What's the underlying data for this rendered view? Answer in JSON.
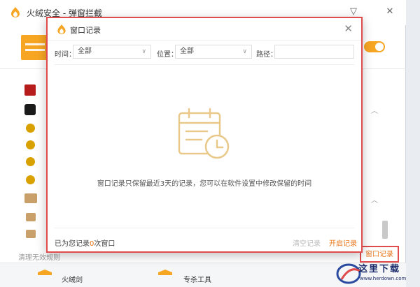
{
  "main_window": {
    "title": "火绒安全 - 弹窗拦截",
    "minimize_label": "▽",
    "close_label": "✕",
    "cleanup_label": "清理无效规则",
    "record_button_label": "窗口记录",
    "bottom_tools": [
      "火绒剑",
      "专杀工具"
    ]
  },
  "dialog": {
    "title": "窗口记录",
    "close_label": "✕",
    "filters": {
      "time_label": "时间：",
      "time_value": "全部",
      "position_label": "位置：",
      "position_value": "全部",
      "path_label": "路径：",
      "path_value": ""
    },
    "empty_message": "窗口记录只保留最近3天的记录，您可以在软件设置中修改保留的时间",
    "footer": {
      "record_prefix": "已为您记录",
      "record_count": "0",
      "record_suffix": "次窗口",
      "clear_label": "清空记录",
      "open_label": "开启记录"
    }
  },
  "watermark": {
    "text": "这里下载",
    "url": "www.herdown.com"
  },
  "colors": {
    "accent": "#f7a623",
    "link_orange": "#e8761a",
    "highlight_red": "#e04b4b"
  }
}
